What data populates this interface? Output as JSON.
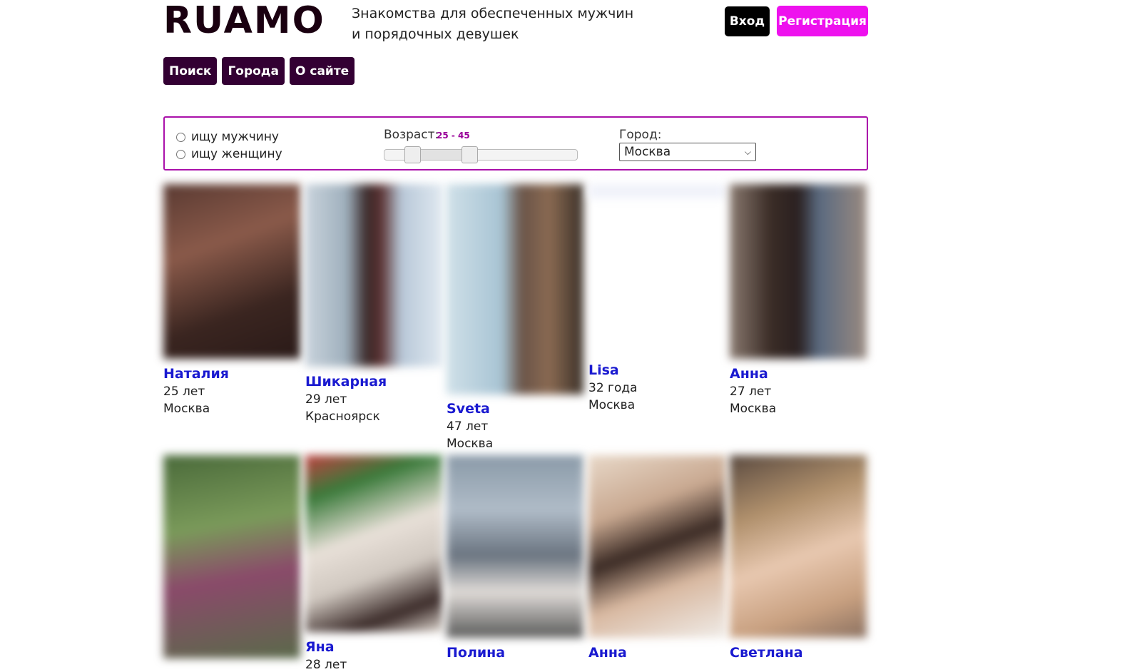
{
  "header": {
    "logo": "RUAMO",
    "tagline_line1": "Знакомства для обеспеченных мужчин",
    "tagline_line2": "и порядочных девушек",
    "login_label": "Вход",
    "register_label": "Регистрация"
  },
  "nav": {
    "search": "Поиск",
    "cities": "Города",
    "about": "О сайте"
  },
  "filter": {
    "seek_man": "ищу мужчину",
    "seek_woman": "ищу женщину",
    "age_label": "Возраст:",
    "age_range": "25 - 45",
    "age_min": 25,
    "age_max": 45,
    "city_label": "Город:",
    "city_selected": "Москва"
  },
  "profiles": [
    {
      "name": "Наталия",
      "age": "25 лет",
      "city": "Москва"
    },
    {
      "name": "Шикарная",
      "age": "29 лет",
      "city": "Красноярск"
    },
    {
      "name": "Sveta",
      "age": "47 лет",
      "city": "Москва"
    },
    {
      "name": "Lisa",
      "age": "32 года",
      "city": "Москва"
    },
    {
      "name": "Анна",
      "age": "27 лет",
      "city": "Москва"
    },
    {
      "name": "Яна",
      "age": "28 лет",
      "city": ""
    },
    {
      "name": "Полина",
      "age": "",
      "city": ""
    },
    {
      "name": "Анна",
      "age": "",
      "city": ""
    },
    {
      "name": "Светлана",
      "age": "",
      "city": ""
    }
  ],
  "colors": {
    "brand_magenta": "#ee11ee",
    "nav_dark": "#330033",
    "link_blue": "#1a1ad0",
    "filter_border": "#aa11aa"
  }
}
